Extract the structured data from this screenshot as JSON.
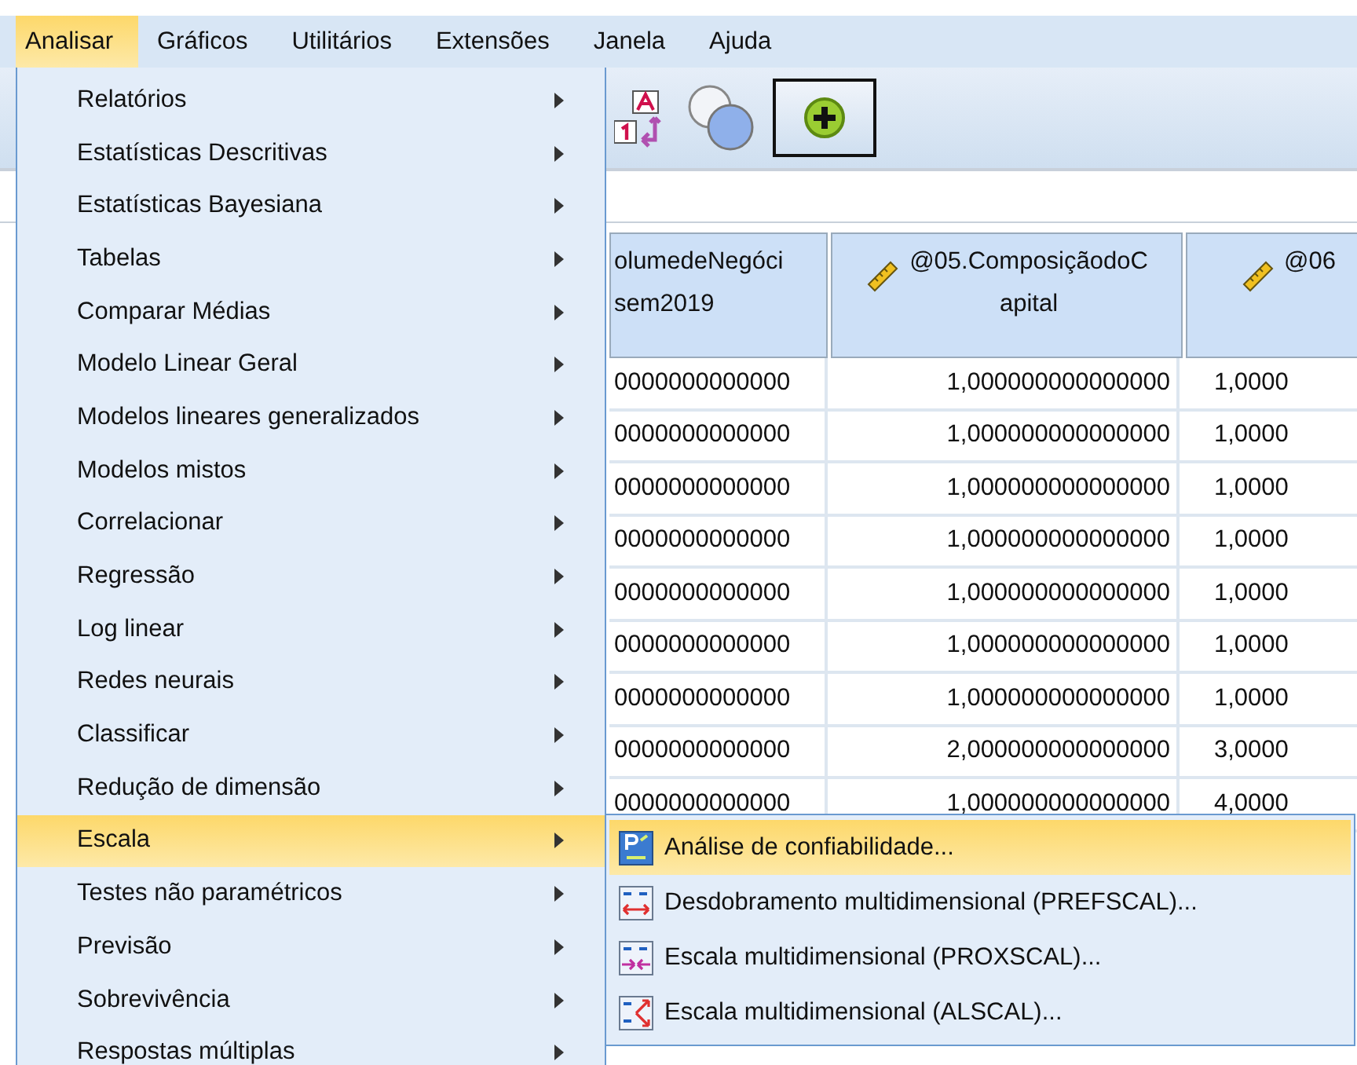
{
  "menu_bar": [
    {
      "label": "Analisar",
      "selected": true
    },
    {
      "label": "Gráficos",
      "selected": false
    },
    {
      "label": "Utilitários",
      "selected": false
    },
    {
      "label": "Extensões",
      "selected": false
    },
    {
      "label": "Janela",
      "selected": false
    },
    {
      "label": "Ajuda",
      "selected": false
    }
  ],
  "toolbar": [
    {
      "kind": "labels",
      "pressed": false
    },
    {
      "kind": "venn",
      "pressed": false
    },
    {
      "kind": "add",
      "pressed": true
    }
  ],
  "table": {
    "columns": [
      {
        "lines": [
          "olumedeNegóci",
          "sem2019"
        ],
        "measure": false
      },
      {
        "lines": [
          "@05.ComposiçãodoC",
          "apital"
        ],
        "measure": true
      },
      {
        "lines": [
          "@06"
        ],
        "measure": true
      }
    ],
    "rows": [
      [
        "0000000000000",
        "1,000000000000000",
        "1,0000"
      ],
      [
        "0000000000000",
        "1,000000000000000",
        "1,0000"
      ],
      [
        "0000000000000",
        "1,000000000000000",
        "1,0000"
      ],
      [
        "0000000000000",
        "1,000000000000000",
        "1,0000"
      ],
      [
        "0000000000000",
        "1,000000000000000",
        "1,0000"
      ],
      [
        "0000000000000",
        "1,000000000000000",
        "1,0000"
      ],
      [
        "0000000000000",
        "1,000000000000000",
        "1,0000"
      ],
      [
        "0000000000000",
        "2,000000000000000",
        "3,0000"
      ],
      [
        "0000000000000",
        "1,000000000000000",
        "4,0000"
      ]
    ]
  },
  "analyze_menu": [
    {
      "label": "Relatórios",
      "selected": false
    },
    {
      "label": "Estatísticas Descritivas",
      "selected": false
    },
    {
      "label": "Estatísticas Bayesiana",
      "selected": false
    },
    {
      "label": "Tabelas",
      "selected": false
    },
    {
      "label": "Comparar Médias",
      "selected": false
    },
    {
      "label": "Modelo Linear Geral",
      "selected": false
    },
    {
      "label": "Modelos lineares generalizados",
      "selected": false
    },
    {
      "label": "Modelos mistos",
      "selected": false
    },
    {
      "label": "Correlacionar",
      "selected": false
    },
    {
      "label": "Regressão",
      "selected": false
    },
    {
      "label": "Log linear",
      "selected": false
    },
    {
      "label": "Redes neurais",
      "selected": false
    },
    {
      "label": "Classificar",
      "selected": false
    },
    {
      "label": "Redução de dimensão",
      "selected": false
    },
    {
      "label": "Escala",
      "selected": true
    },
    {
      "label": "Testes não paramétricos",
      "selected": false
    },
    {
      "label": "Previsão",
      "selected": false
    },
    {
      "label": "Sobrevivência",
      "selected": false
    },
    {
      "label": "Respostas múltiplas",
      "selected": false
    }
  ],
  "scale_submenu": [
    {
      "label": "Análise de confiabilidade...",
      "kind": "reliability",
      "selected": true
    },
    {
      "label": "Desdobramento multidimensional (PREFSCAL)...",
      "kind": "prefscal",
      "selected": false
    },
    {
      "label": "Escala multidimensional (PROXSCAL)...",
      "kind": "proxscal",
      "selected": false
    },
    {
      "label": "Escala multidimensional (ALSCAL)...",
      "kind": "alscal",
      "selected": false
    }
  ]
}
